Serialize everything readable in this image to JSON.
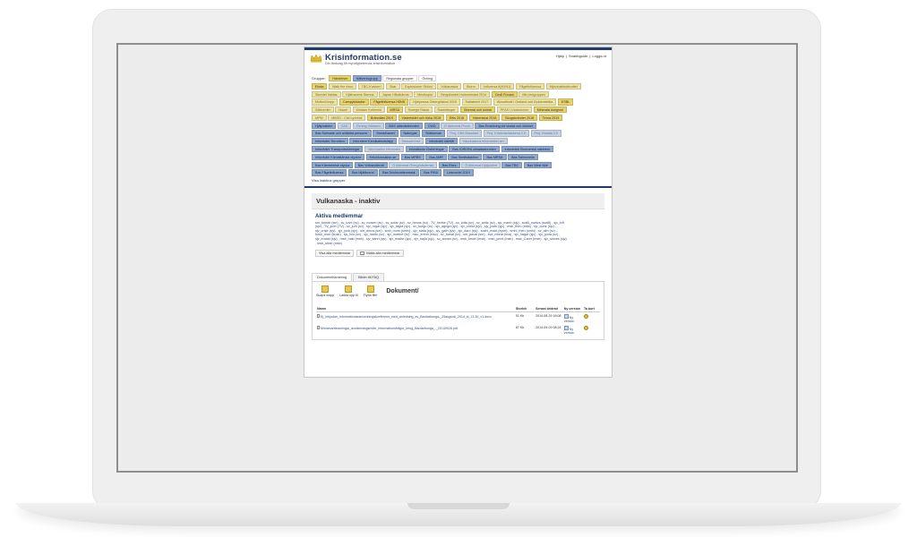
{
  "header": {
    "brand": "Krisinformation.se",
    "tagline": "Din länkväg till myndigheternas krisinformation",
    "links": [
      "Hjälp",
      "|",
      "Snabbguide",
      "|",
      "Logga ut"
    ]
  },
  "groups": {
    "label": "Grupper:",
    "tabs": [
      {
        "label": "Händelser",
        "style": "c-y"
      },
      {
        "label": "Nätverksgrupp",
        "style": "c-b"
      },
      {
        "label": "Regionala grupper",
        "style": "c-w"
      },
      {
        "label": "Övning",
        "style": "c-w"
      }
    ],
    "rows": [
      [
        {
          "label": "Ebola",
          "style": "c-y"
        },
        {
          "label": "Walk the virus",
          "style": "c-ly"
        },
        {
          "label": "TBC-Kusiven",
          "style": "c-ly"
        },
        {
          "label": "Skar",
          "style": "c-ly"
        },
        {
          "label": "Explosioner Skövd",
          "style": "c-ly"
        },
        {
          "label": "Vulkanaska",
          "style": "c-ly"
        },
        {
          "label": "Storm",
          "style": "c-ly"
        },
        {
          "label": "Influensa A(H1N1)",
          "style": "c-ly"
        },
        {
          "label": "Fågelinfluensa",
          "style": "c-ly"
        },
        {
          "label": "Mykobaktsutbrottet",
          "style": "c-ly"
        }
      ],
      [
        {
          "label": "Skredet Vaklas",
          "style": "c-ly"
        },
        {
          "label": "Hjälmarens Stenna",
          "style": "c-ly"
        },
        {
          "label": "Japan Hårdbärma",
          "style": "c-ly"
        },
        {
          "label": "Mexikopst",
          "style": "c-ly"
        },
        {
          "label": "Bergskredet Hodsmestad 2014",
          "style": "c-ly"
        },
        {
          "label": "Cecil Frouan",
          "style": "c-y"
        },
        {
          "label": "Min-ledgruppen",
          "style": "c-ly"
        }
      ],
      [
        {
          "label": "MoftonDorpp",
          "style": "c-ly"
        },
        {
          "label": "Campylobacter",
          "style": "c-y"
        },
        {
          "label": "Fågelinfluensa H5N8",
          "style": "c-y"
        },
        {
          "label": "Hjälpmsas Östergötland 2015",
          "style": "c-ly"
        },
        {
          "label": "Saltaberni 2017",
          "style": "c-ly"
        },
        {
          "label": "Älvsutbrott i Gotland och Epidemietika",
          "style": "c-ly"
        },
        {
          "label": "ESBL",
          "style": "c-y"
        }
      ],
      [
        {
          "label": "Söktornier",
          "style": "c-ly"
        },
        {
          "label": "Naoel",
          "style": "c-ly"
        },
        {
          "label": "Kristam Kvillemin",
          "style": "c-ly"
        },
        {
          "label": "MRSA",
          "style": "c-y"
        },
        {
          "label": "Sverige Rasta",
          "style": "c-ly"
        },
        {
          "label": "Raststänger",
          "style": "c-ly"
        },
        {
          "label": "Stormar och snöstr",
          "style": "c-y"
        },
        {
          "label": "PFAS i Uroboeolon",
          "style": "c-ly"
        },
        {
          "label": "Mineralà üorigiost",
          "style": "c-y"
        }
      ],
      [
        {
          "label": "MPM",
          "style": "c-ly"
        },
        {
          "label": "MBSD - Cist Lynnbal",
          "style": "c-ly"
        },
        {
          "label": "Bränntäst 2019",
          "style": "c-y"
        },
        {
          "label": "Väderisklet och törka 2018",
          "style": "c-y"
        },
        {
          "label": "Ettis 2018",
          "style": "c-y"
        },
        {
          "label": "Väderiskat 2018",
          "style": "c-y"
        },
        {
          "label": "Skogsbränder 2018",
          "style": "c-y"
        },
        {
          "label": "Terna 2019",
          "style": "c-y"
        }
      ],
      [
        {
          "label": "Hjälpvakten",
          "style": "c-b"
        },
        {
          "label": "SAS",
          "style": "c-lb"
        },
        {
          "label": "Övning Vällasen",
          "style": "c-lb"
        },
        {
          "label": "BAS utlandsärenden",
          "style": "c-b"
        },
        {
          "label": "CWD",
          "style": "c-b"
        },
        {
          "label": "Ö Aktiverat Phom",
          "style": "c-lb"
        },
        {
          "label": "Bas Enskilning vid skada och olöshet",
          "style": "c-b"
        }
      ],
      [
        {
          "label": "Bas Salmade och avfäldra personer",
          "style": "c-b"
        },
        {
          "label": "Samsthavert",
          "style": "c-b"
        },
        {
          "label": "Naturgas",
          "style": "c-b"
        },
        {
          "label": "Sölstormar",
          "style": "c-b"
        },
        {
          "label": "Proj. CMI-Standard",
          "style": "c-lb"
        },
        {
          "label": "Proj. Krisionsmiadorna 2.0",
          "style": "c-lb"
        },
        {
          "label": "Proj. Rusata 2.0",
          "style": "c-lb"
        }
      ],
      [
        {
          "label": "Infordvärk Terrorism",
          "style": "c-b"
        },
        {
          "label": "Informenr Kemikalieutsläpp",
          "style": "c-b"
        },
        {
          "label": "Marsatverad",
          "style": "c-lb"
        },
        {
          "label": "Infordvärk kärnfäl",
          "style": "c-b"
        },
        {
          "label": "Vaccinations information sm",
          "style": "c-lb"
        }
      ],
      [
        {
          "label": "Infordvärk Transportstörningar",
          "style": "c-b"
        },
        {
          "label": "Vaccination informatio",
          "style": "c-lb"
        },
        {
          "label": "Infordtkedn Elstörningar",
          "style": "c-b"
        },
        {
          "label": "Bas IORDRA olössttsärenden",
          "style": "c-b"
        },
        {
          "label": "Infordvärk Ekonomisk säkerhet",
          "style": "c-b"
        }
      ],
      [
        {
          "label": "Infordvärk Klimatkänsla olyckor",
          "style": "c-b"
        },
        {
          "label": "Krisinformation.se",
          "style": "c-b"
        },
        {
          "label": "Bas MRBS",
          "style": "c-b"
        },
        {
          "label": "Bas AMR",
          "style": "c-b"
        },
        {
          "label": "Bas Smittsäaktion",
          "style": "c-b"
        },
        {
          "label": "Bas MRSA",
          "style": "c-b"
        },
        {
          "label": "Bas Salmonella",
          "style": "c-b"
        }
      ],
      [
        {
          "label": "Bas Kärnteknisk olycka",
          "style": "c-b"
        },
        {
          "label": "Bas Vulkanutbrott",
          "style": "c-b"
        },
        {
          "label": "Ö Aktiverat Övergödsvärnsk",
          "style": "c-lb"
        },
        {
          "label": "Bas Ebec",
          "style": "c-b"
        },
        {
          "label": "Ö Aktiverat Hjälpraimt",
          "style": "c-lb"
        },
        {
          "label": "Bas TBC",
          "style": "c-b"
        },
        {
          "label": "Bas West Nile",
          "style": "c-b"
        }
      ],
      [
        {
          "label": "Bas Fågelinfluensa",
          "style": "c-b"
        },
        {
          "label": "Bas Mjältbrand",
          "style": "c-b"
        },
        {
          "label": "Bas Dricksvattenmask",
          "style": "c-b"
        },
        {
          "label": "Bas PIBD",
          "style": "c-b"
        },
        {
          "label": "Livsmedel 2019",
          "style": "c-b"
        }
      ]
    ],
    "show_all": "Visa inaktiva grupper"
  },
  "page": {
    "title": "Vulkanaska - inaktiv",
    "members_title": "Aktiva medlemmar",
    "members_text": "sm_tomah (sm) , sv_tove (sv) , sv_mosen (sv) , sv_sofar (sv) , sv_henos (so) , TV_henke (TV) , sv_lotta (sv) , sv_anitz (sv) , sjv_manh (sjv) , scaB_mwtos (scaB) , sjv_krlf (sjv) , TV_johh (TV) , sv_jorh (sv) , sjv_rogar (sjv) , sjv_tagra (sjv) , sv_kurgu (sv) , sjv_agnga (sjv) , sjv_christ (sjv) , sjv_josfn (sjv) , msb_thèo (msb) , sjv_curte (sjv) , sjv_craje (sjv) , sjv_jonb (sjv) , sm_anrcs (sm) , smh_mors (smhi) , sjv_stata (sjv) , sjv_gath (sjv) , sjv_daro (sjv) , soshi_maxt (sysrt) , smhi_then (smhi) , sv_alm (sv) , kusb_morr (kusb) , sjv_lulo (sv) , sjv_hantu (sv) , sjv_martne (sv) , msc_enmb (msc) , sv_hanat (sv) , sm_pauai (sm) , sva_mbrar (sva) , sjv_hagar (sjv) , sjv_jonta (sv) , sjv_emast (sjv) , msb_haki (msb) , sjv_sarel (sjv) , sjv_madsr (sjv) , sjv_bajla (sjv) , sv_annan (sv) , msb_kenel (msb) , msb_jonnl (msb) , msb_Carer (msb) , sjv_stoves (sjv) , msb_stixin (msb)",
    "btn_show_all": "Visa alla medlemmar",
    "btn_mail_all": "Maila alla medlemmar",
    "tabs": [
      "Dokumenthantering",
      "Bilder till FAQ"
    ],
    "tools": [
      "Skapa mapp",
      "Ladda upp fil",
      "Flytta filer"
    ],
    "doc_title": "Dokument/",
    "table": {
      "headers": [
        "Namn",
        "Storlek",
        "Senast ändrad",
        "Ny version",
        "Ta bort"
      ],
      "rows": [
        {
          "name": "Ej_Inbjudan_informationssamordningskonferens_med_anledning_av_Bardarbunga-_29augusti_2014_kl_13.30_v1.docx",
          "size": "51 Kb",
          "modified": "2014-08-29 16:08",
          "version": "Ny version"
        },
        {
          "name": "Minnesanteckningar_avstämningsmöte_informationsfrågor_kring_Bardarbunga_-_20140926.pdf",
          "size": "87 Kb",
          "modified": "2014-09-03 08:24",
          "version": "Ny version"
        }
      ]
    }
  }
}
